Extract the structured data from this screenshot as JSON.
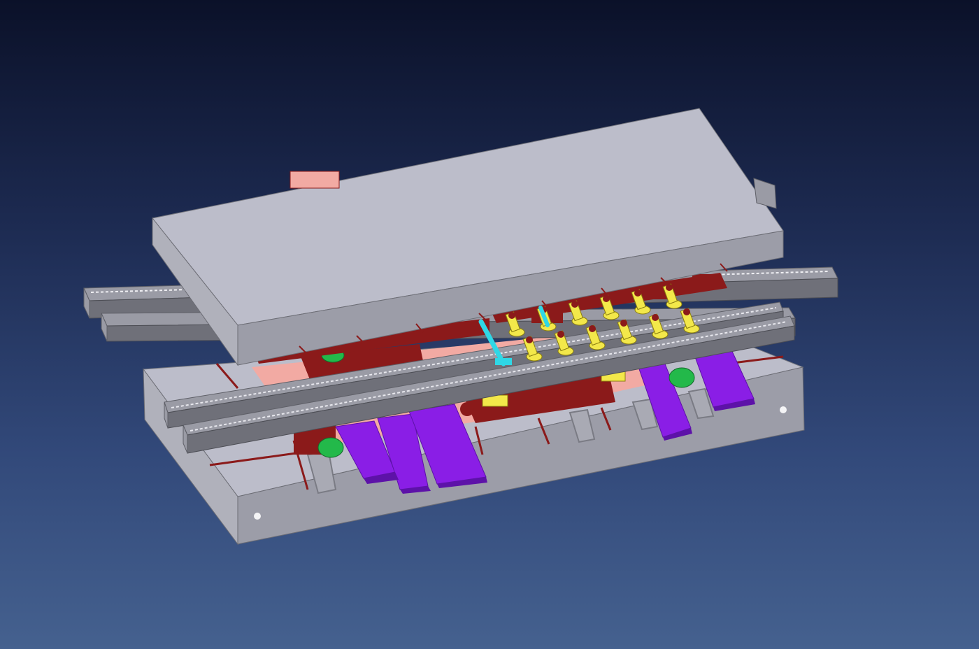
{
  "viewport": {
    "background_top": "#0b1129",
    "background_bottom": "#45618f"
  },
  "model": {
    "colors": {
      "plate_top": "#bcbdca",
      "plate_front": "#9c9da8",
      "plate_side": "#b0b1bb",
      "rail": "#9a9ba5",
      "rail_dark": "#6f7079",
      "die_parts": "#8b1a1a",
      "die_parts_light": "#f2aaa3",
      "lifter": "#8a1ee6",
      "lifter_dark": "#5d12a8",
      "cylinder": "#f3e84a",
      "pusher": "#2fd7e6",
      "cushion": "#23b94a"
    }
  }
}
